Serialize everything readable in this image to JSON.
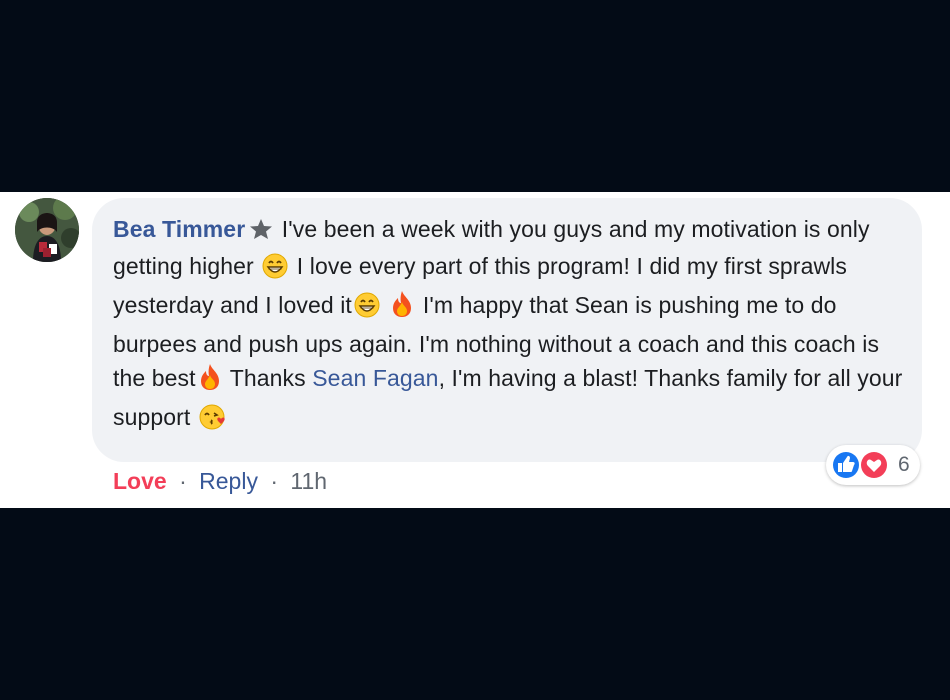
{
  "comment": {
    "author": "Bea Timmer",
    "text_1": " I've been a week with you guys and my motivation is only getting higher ",
    "text_2": " I love every part of this program! I did my first sprawls yesterday and I loved it",
    "text_3": " I'm happy that Sean is pushing me to do burpees and push ups again. I'm nothing without a coach and this coach is the best",
    "text_4": " Thanks ",
    "mention": "Sean Fagan",
    "text_5": ", I'm having a blast! Thanks family for all your support ",
    "badge_icon": "top-fan-star-icon",
    "emojis": [
      "grinning-face-icon",
      "grinning-face-icon",
      "fire-icon",
      "fire-icon",
      "kissing-heart-face-icon"
    ]
  },
  "reactions": {
    "count": "6",
    "icons": [
      "like-reaction-icon",
      "love-reaction-icon"
    ]
  },
  "actions": {
    "love": "Love",
    "sep1": "·",
    "reply": "Reply",
    "sep2": "·",
    "time": "11h"
  },
  "colors": {
    "background": "#030b16",
    "bubble": "#f0f2f5",
    "link": "#385898",
    "love": "#f33e58",
    "like_blue": "#1877f2"
  }
}
